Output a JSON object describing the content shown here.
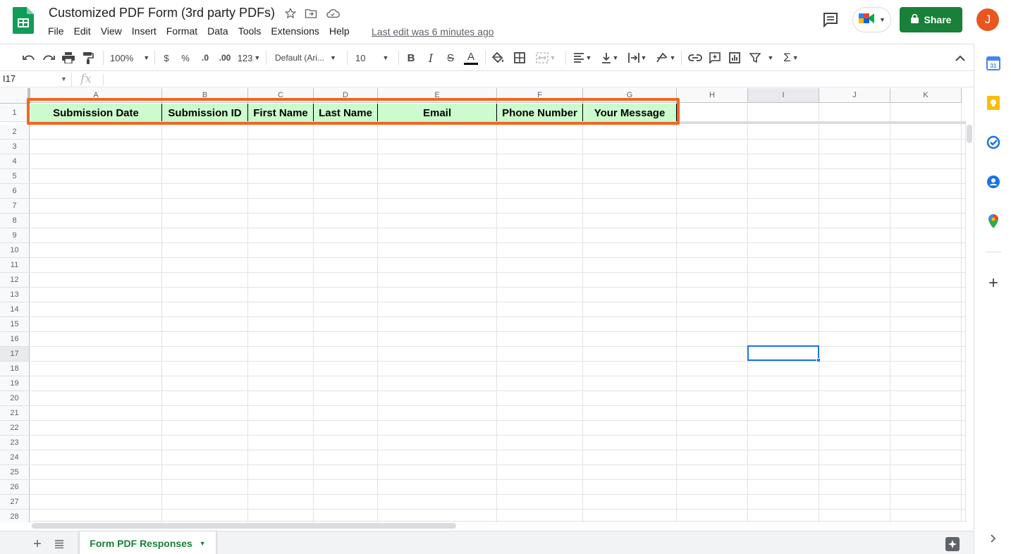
{
  "window": {
    "title": "Customized PDF Form (3rd party PDFs)",
    "last_edit": "Last edit was 6 minutes ago"
  },
  "menu": [
    "File",
    "Edit",
    "View",
    "Insert",
    "Format",
    "Data",
    "Tools",
    "Extensions",
    "Help"
  ],
  "header_buttons": {
    "share_label": "Share",
    "avatar_initial": "J"
  },
  "toolbar": {
    "zoom": "100%",
    "currency": "$",
    "percent": "%",
    "decrease_decimal": ".0",
    "increase_decimal": ".00",
    "number_format": "123",
    "font_family": "Default (Ari...",
    "font_size": "10"
  },
  "formula_bar": {
    "name_box": "I17",
    "fx_label": "fx"
  },
  "columns": [
    "A",
    "B",
    "C",
    "D",
    "E",
    "F",
    "G",
    "H",
    "I",
    "J",
    "K"
  ],
  "rows": [
    "1",
    "2",
    "3",
    "4",
    "5",
    "6",
    "7",
    "8",
    "9",
    "10",
    "11",
    "12",
    "13",
    "14",
    "15",
    "16",
    "17",
    "18",
    "19",
    "20",
    "21",
    "22",
    "23",
    "24",
    "25",
    "26",
    "27",
    "28"
  ],
  "header_row": [
    "Submission Date",
    "Submission ID",
    "First Name",
    "Last Name",
    "Email",
    "Phone Number",
    "Your Message"
  ],
  "selected_cell": "I17",
  "colors": {
    "header_fill": "#ccfcce",
    "highlight_border": "#f26522",
    "share_green": "#188038",
    "selection_blue": "#1a73e8"
  },
  "sheet_tab": {
    "name": "Form PDF Responses"
  },
  "side_panel_icons": [
    "calendar-icon",
    "keep-icon",
    "tasks-icon",
    "contacts-icon",
    "maps-icon",
    "add-icon"
  ]
}
